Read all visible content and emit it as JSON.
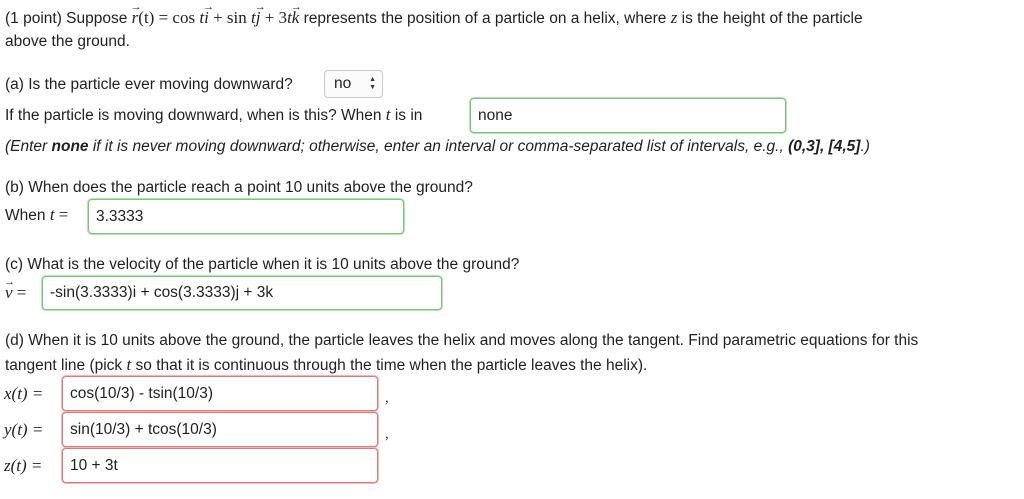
{
  "intro": {
    "prefix": "(1 point) Suppose ",
    "r_def": {
      "r": "r",
      "t_arg": "(t) = cos ",
      "t1": "t",
      "i": "i",
      "plus1": " + sin ",
      "t2": "t",
      "j": "j",
      "plus2": " + 3",
      "t3": "t",
      "k": "k"
    },
    "mid": " represents the position of a particle on a helix, where ",
    "z_var": "z",
    "suffix": " is the height of the particle",
    "line2": "above the ground."
  },
  "part_a": {
    "question": "(a) Is the particle ever moving downward?",
    "select_value": "no",
    "follow_up_prefix": "If the particle is moving downward, when is this? When ",
    "t_var": "t",
    "follow_up_suffix": " is in",
    "interval_answer": "none",
    "hint_prefix": "(Enter ",
    "hint_bold": "none",
    "hint_mid": " if it is never moving downward; otherwise, enter an interval or comma-separated list of intervals, e.g., ",
    "hint_example": "(0,3], [4,5]",
    "hint_suffix": ".)"
  },
  "part_b": {
    "question": "(b) When does the particle reach a point 10 units above the ground?",
    "label_prefix": "When ",
    "t_var": "t",
    "label_eq": " =",
    "answer": "3.3333"
  },
  "part_c": {
    "question": "(c) What is the velocity of the particle when it is 10 units above the ground?",
    "v_var": "v",
    "label_eq": " =",
    "answer": "-sin(3.3333)i + cos(3.3333)j + 3k"
  },
  "part_d": {
    "question_line1": "(d) When it is 10 units above the ground, the particle leaves the helix and moves along the tangent. Find parametric equations for this",
    "question_line2_prefix": "tangent line (pick ",
    "t_var": "t",
    "question_line2_suffix": " so that it is continuous through the time when the particle leaves the helix).",
    "x_label": "x(t) =",
    "x_answer": "cos(10/3) - tsin(10/3)",
    "y_label": "y(t) =",
    "y_answer": "sin(10/3) + tcos(10/3)",
    "z_label": "z(t) =",
    "z_answer": "10 + 3t",
    "separator": ","
  },
  "colors": {
    "correct_border": "#7cc37c",
    "incorrect_border": "#e07a7a"
  }
}
